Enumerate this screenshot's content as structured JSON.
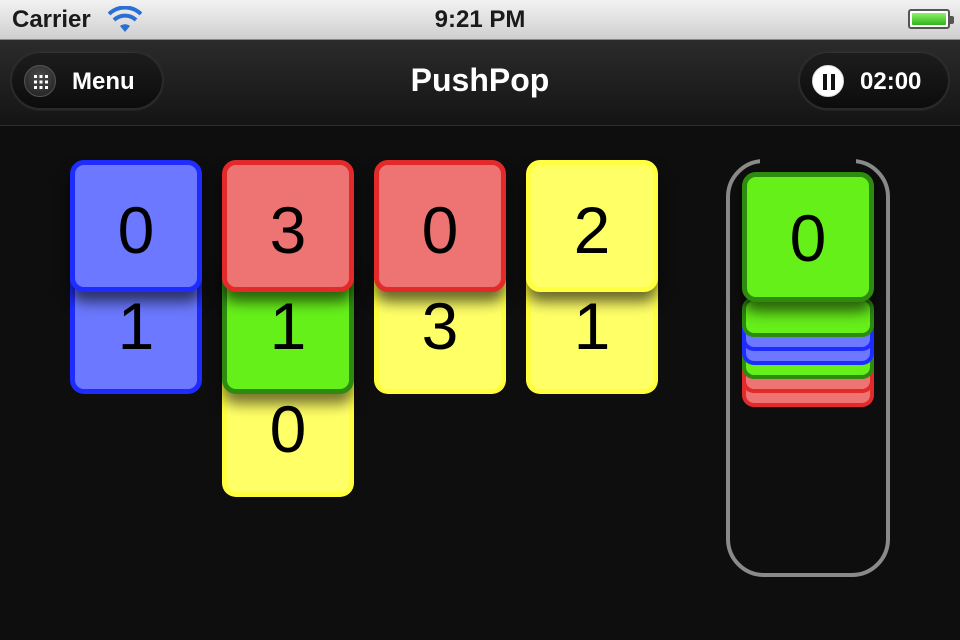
{
  "status_bar": {
    "carrier": "Carrier",
    "time": "9:21 PM"
  },
  "nav": {
    "title": "PushPop",
    "menu_label": "Menu",
    "timer_label": "02:00"
  },
  "colors": {
    "blue": "#6b78ff",
    "red": "#ee7373",
    "green": "#66f01a",
    "yellow": "#ffff66"
  },
  "board": {
    "columns": [
      {
        "tiles": [
          {
            "value": "0",
            "color": "blue"
          },
          {
            "value": "1",
            "color": "blue"
          }
        ]
      },
      {
        "tiles": [
          {
            "value": "3",
            "color": "red"
          },
          {
            "value": "1",
            "color": "green"
          },
          {
            "value": "0",
            "color": "yellow"
          }
        ]
      },
      {
        "tiles": [
          {
            "value": "0",
            "color": "red"
          },
          {
            "value": "3",
            "color": "yellow"
          }
        ]
      },
      {
        "tiles": [
          {
            "value": "2",
            "color": "yellow"
          },
          {
            "value": "1",
            "color": "yellow"
          }
        ]
      }
    ]
  },
  "tube": {
    "top_card": {
      "value": "0",
      "color": "green"
    },
    "stack_colors": [
      "green",
      "blue",
      "blue",
      "green",
      "red",
      "red"
    ]
  }
}
